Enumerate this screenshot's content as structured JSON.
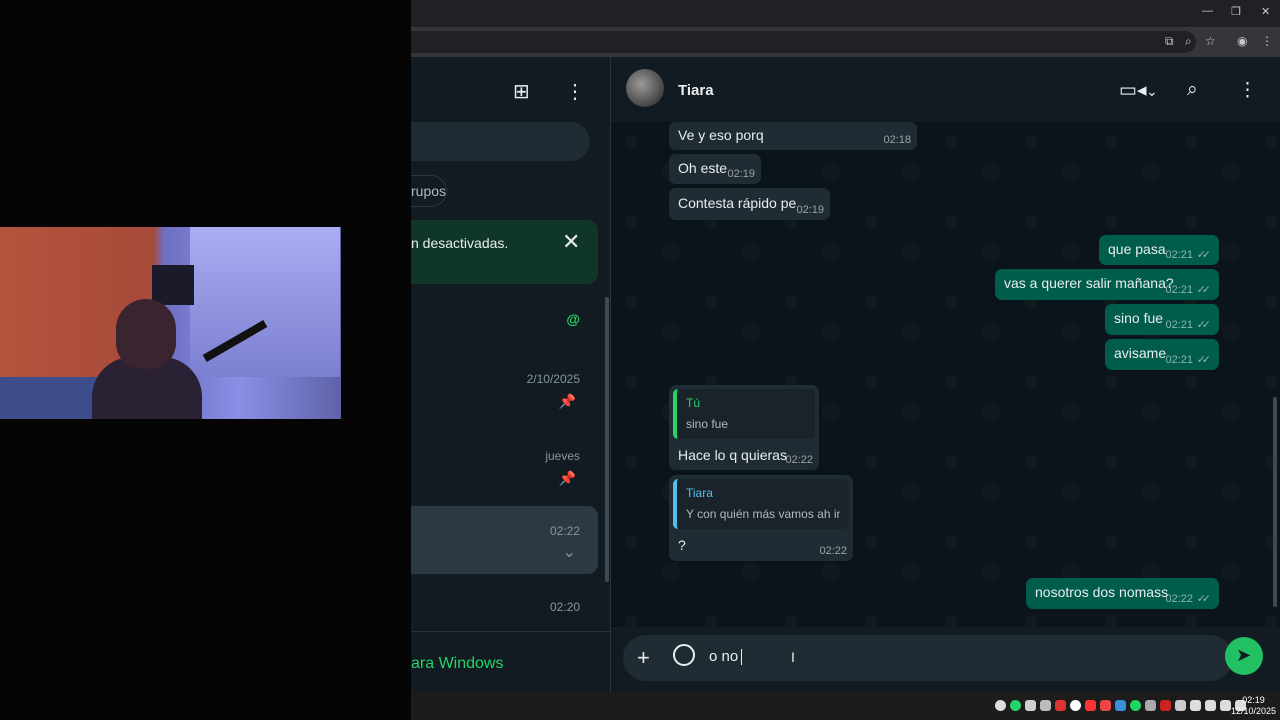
{
  "window": {
    "min_glyph": "—",
    "max_glyph": "❐",
    "close_glyph": "✕"
  },
  "sidebar": {
    "filter_chip": "rupos",
    "notice": "n desactivadas.",
    "chats": [
      {
        "time": "",
        "mention": "@"
      },
      {
        "time": "2/10/2025"
      },
      {
        "time": "jueves"
      },
      {
        "time": "02:22"
      },
      {
        "time": "02:20"
      }
    ],
    "windows_link": "ara Windows"
  },
  "chat": {
    "contact_name": "Tiara",
    "messages": [
      {
        "dir": "in",
        "text": "Ve y eso porq",
        "time": "02:18"
      },
      {
        "dir": "in",
        "text": "Oh este",
        "time": "02:19"
      },
      {
        "dir": "in",
        "text": "Contesta rápido pe",
        "time": "02:19"
      },
      {
        "dir": "out",
        "text": "que pasa",
        "time": "02:21"
      },
      {
        "dir": "out",
        "text": "vas a querer salir mañana?",
        "time": "02:21"
      },
      {
        "dir": "out",
        "text": "sino fue",
        "time": "02:21"
      },
      {
        "dir": "out",
        "text": "avisame",
        "time": "02:21"
      },
      {
        "dir": "in",
        "quote_author": "Tú",
        "quote_text": "sino fue",
        "text": "Hace lo q quieras",
        "time": "02:22"
      },
      {
        "dir": "in",
        "quote_author": "Tiara",
        "quote_text": "Y con quién más vamos ah ir",
        "text": "?",
        "time": "02:22"
      },
      {
        "dir": "out",
        "text": "nosotros dos nomass",
        "time": "02:22"
      }
    ],
    "draft": "o no"
  },
  "taskbar": {
    "time": "02:19",
    "date": "12/10/2025"
  },
  "colors": {
    "accent": "#25d366",
    "outgoing": "#005c4b",
    "incoming": "#202c33",
    "send": "#21c063"
  }
}
